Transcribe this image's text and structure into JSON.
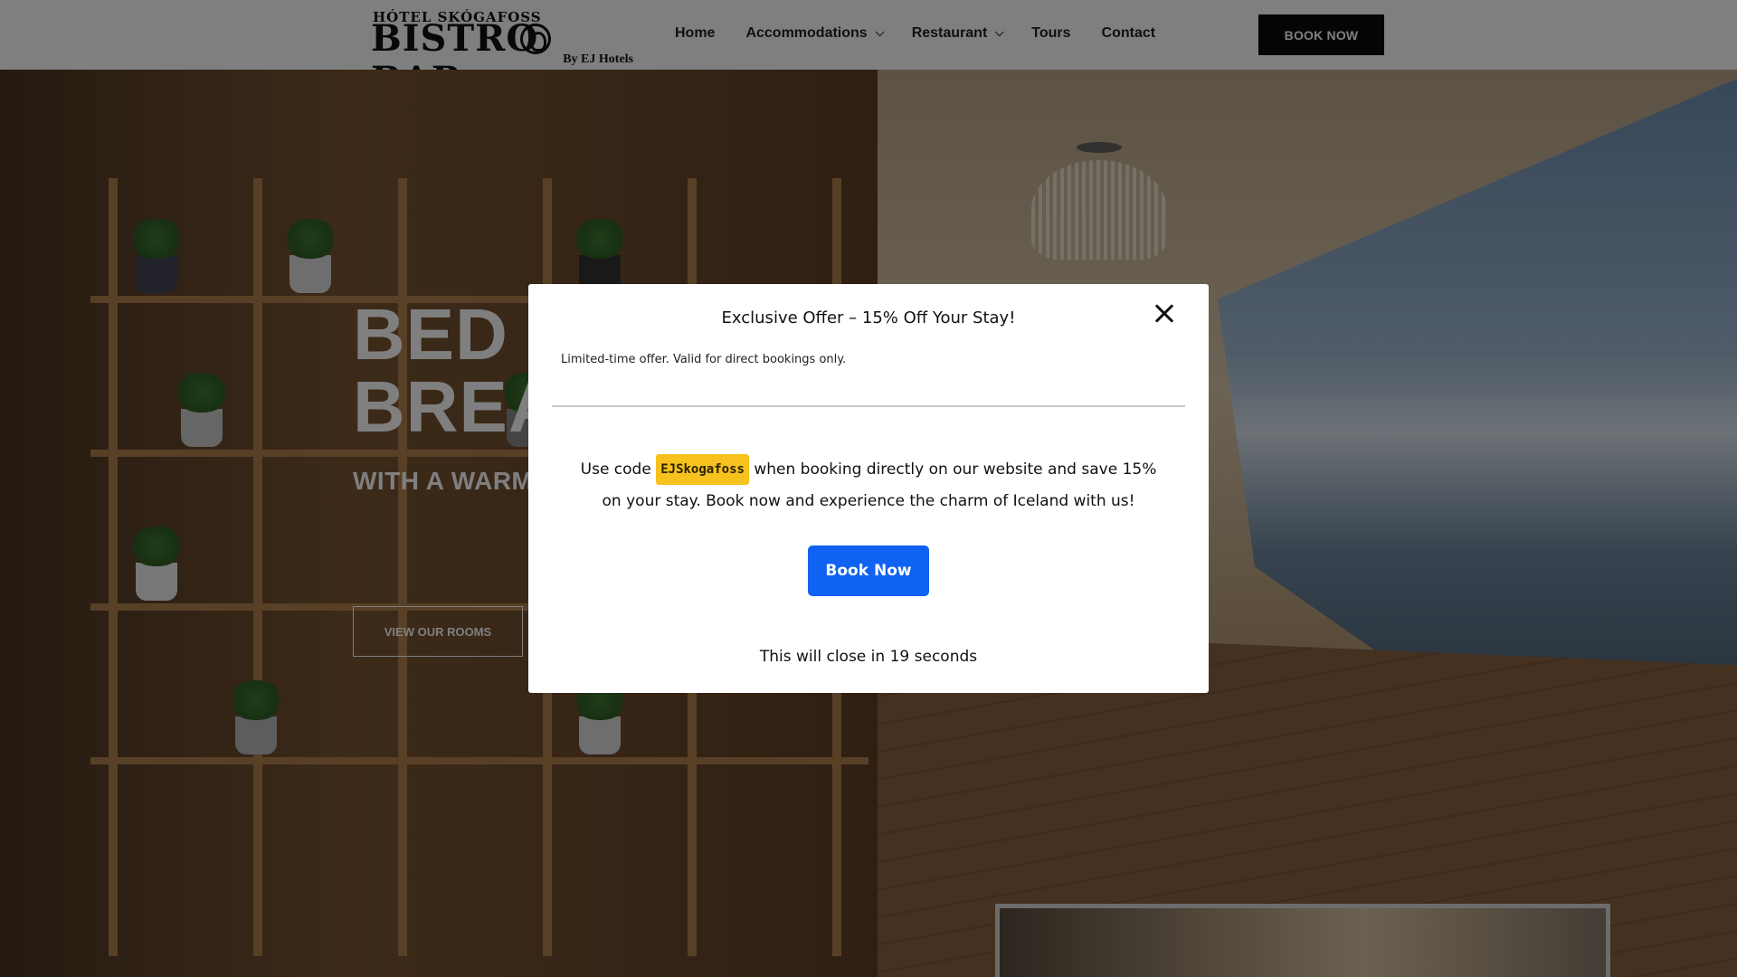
{
  "header": {
    "logo": {
      "top_line": "HÓTEL SKÓGAFOSS",
      "main": "BISTRO BAR",
      "by_line": "By EJ Hotels"
    },
    "nav": [
      {
        "label": "Home",
        "dropdown": false
      },
      {
        "label": "Accommodations",
        "dropdown": true
      },
      {
        "label": "Restaurant",
        "dropdown": true
      },
      {
        "label": "Tours",
        "dropdown": false
      },
      {
        "label": "Contact",
        "dropdown": false
      }
    ],
    "book_now_label": "BOOK NOW"
  },
  "hero": {
    "title_line1": "BED &",
    "title_line2": "BREA",
    "subtitle": "WITH A WARM",
    "cta_label": "VIEW OUR ROOMS"
  },
  "modal": {
    "title": "Exclusive Offer – 15% Off Your Stay!",
    "note": "Limited-time offer. Valid for direct bookings only.",
    "promo_prefix": "Use code",
    "promo_code": "EJSkogafoss",
    "promo_suffix": "when booking directly on our website and save 15% on your stay. Book now and experience the charm of Iceland with us!",
    "button_label": "Book Now",
    "countdown_prefix": "This will close in",
    "countdown_seconds": "19",
    "countdown_suffix": "seconds",
    "close_icon": "close-icon"
  },
  "colors": {
    "modal_button": "#1062f2",
    "code_highlight": "#f7c21d",
    "header_button": "#0b0b0b",
    "overlay": "rgba(0,0,0,0.5)"
  }
}
